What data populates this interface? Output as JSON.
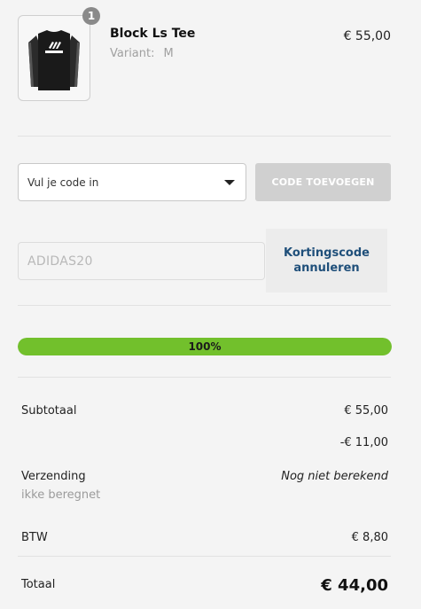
{
  "cart_item": {
    "quantity": "1",
    "name": "Block Ls Tee",
    "variant_label": "Variant:",
    "variant_value": "M",
    "price": "€ 55,00",
    "image_icon": "long-sleeve-shirt-icon"
  },
  "discount": {
    "select_value": "Vul je code in",
    "add_button": "CODE TOEVOEGEN",
    "applied_code": "ADIDAS20",
    "cancel_label": "Kortingscode annuleren"
  },
  "progress": {
    "value": 100,
    "label": "100%",
    "fill_color": "#72c02c"
  },
  "summary": {
    "subtotal_label": "Subtotaal",
    "subtotal_value": "€ 55,00",
    "discount_value": "-€ 11,00",
    "shipping_label": "Verzending",
    "shipping_value": "Nog niet berekend",
    "shipping_note": "ikke beregnet",
    "vat_label": "BTW",
    "vat_value": "€ 8,80",
    "total_label": "Totaal",
    "total_value": "€ 44,00"
  }
}
